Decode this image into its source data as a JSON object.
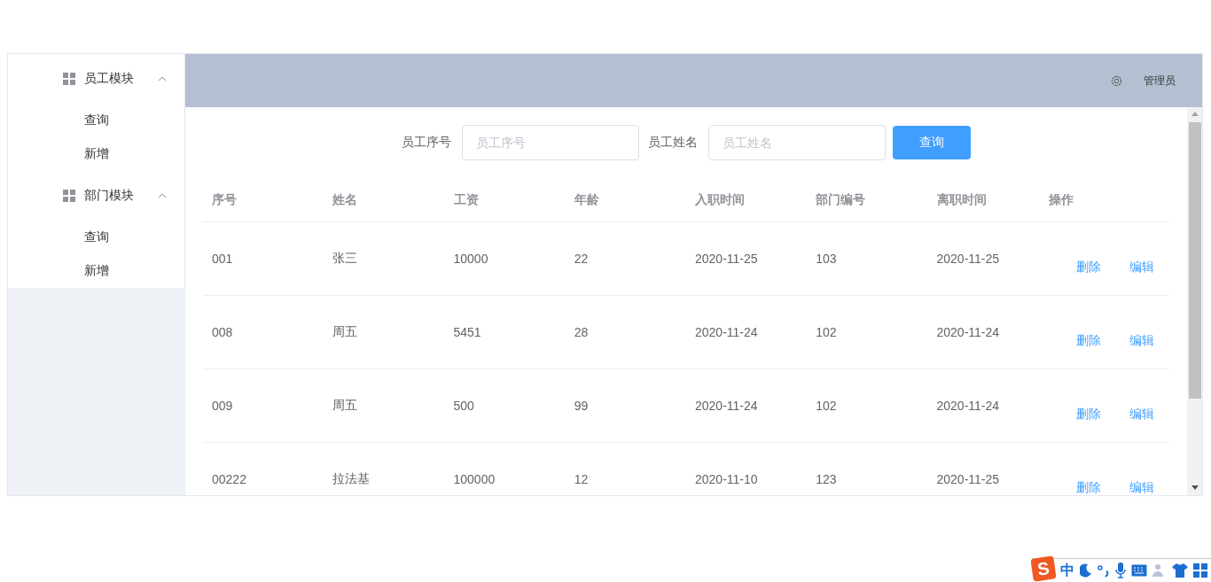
{
  "sidebar": {
    "groups": [
      {
        "label": "员工模块",
        "expanded": true,
        "items": [
          {
            "label": "查询"
          },
          {
            "label": "新增"
          }
        ]
      },
      {
        "label": "部门模块",
        "expanded": true,
        "items": [
          {
            "label": "查询"
          },
          {
            "label": "新增"
          }
        ]
      }
    ]
  },
  "header": {
    "user": "管理员"
  },
  "search": {
    "fields": [
      {
        "label": "员工序号",
        "placeholder": "员工序号"
      },
      {
        "label": "员工姓名",
        "placeholder": "员工姓名"
      }
    ],
    "button": "查询"
  },
  "table": {
    "columns": [
      "序号",
      "姓名",
      "工资",
      "年龄",
      "入职时间",
      "部门编号",
      "离职时间",
      "操作"
    ],
    "rows": [
      {
        "cells": [
          "001",
          "张三",
          "10000",
          "22",
          "2020-11-25",
          "103",
          "2020-11-25"
        ],
        "actions": [
          "删除",
          "编辑"
        ]
      },
      {
        "cells": [
          "008",
          "周五",
          "5451",
          "28",
          "2020-11-24",
          "102",
          "2020-11-24"
        ],
        "actions": [
          "删除",
          "编辑"
        ]
      },
      {
        "cells": [
          "009",
          "周五",
          "500",
          "99",
          "2020-11-24",
          "102",
          "2020-11-24"
        ],
        "actions": [
          "删除",
          "编辑"
        ]
      },
      {
        "cells": [
          "00222",
          "拉法基",
          "100000",
          "12",
          "2020-11-10",
          "123",
          "2020-11-25"
        ],
        "actions": [
          "删除",
          "编辑"
        ]
      }
    ]
  },
  "ime_toolbar": {
    "logo": "S",
    "mode": "中"
  }
}
